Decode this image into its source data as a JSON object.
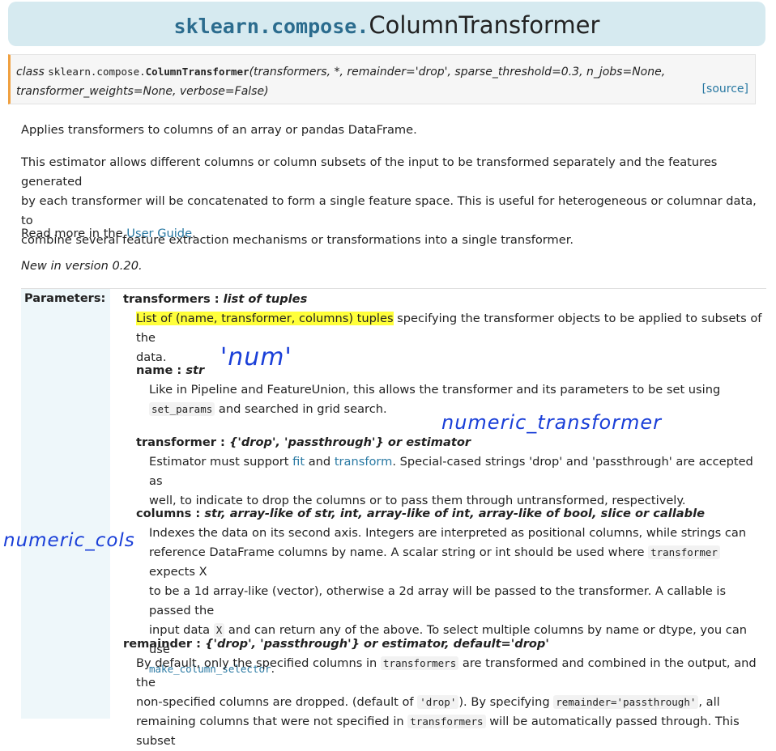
{
  "header": {
    "module": "sklearn.compose.",
    "name": "ColumnTransformer"
  },
  "signature": {
    "keyword": "class",
    "prefix": "sklearn.compose.",
    "cls": "ColumnTransformer",
    "args_line1": "(transformers, *, remainder='drop', sparse_threshold=0.3, n_jobs=None,",
    "args_line2": "transformer_weights=None, verbose=False)",
    "source": "[source]"
  },
  "intro": {
    "p1": "Applies transformers to columns of an array or pandas DataFrame.",
    "p2_l1": "This estimator allows different columns or column subsets of the input to be transformed separately and the features generated",
    "p2_l2": "by each transformer will be concatenated to form a single feature space. This is useful for heterogeneous or columnar data, to",
    "p2_l3": "combine several feature extraction mechanisms or transformations into a single transformer.",
    "p3_pre": "Read more in the ",
    "p3_link": "User Guide",
    "p3_post": ".",
    "p4": "New in version 0.20."
  },
  "params": {
    "label": "Parameters:",
    "transformers": {
      "name": "transformers : ",
      "type": "list of tuples",
      "hl": "List of (name, transformer, columns) tuples",
      "l1_rest": " specifying the transformer objects to be applied to subsets of the",
      "l2": "data."
    },
    "name": {
      "name": "name : ",
      "type": "str",
      "l1": "Like in Pipeline and FeatureUnion, this allows the transformer and its parameters to be set using",
      "code": "set_params",
      "l2_rest": " and searched in grid search."
    },
    "transformer": {
      "name": "transformer : ",
      "type": "{'drop', 'passthrough'} or estimator",
      "l1_pre": "Estimator must support ",
      "fit": "fit",
      "and": " and ",
      "transform": "transform",
      "l1_post": ". Special-cased strings 'drop' and 'passthrough' are accepted as",
      "l2": "well, to indicate to drop the columns or to pass them through untransformed, respectively."
    },
    "columns": {
      "name": "columns : ",
      "type": "str, array-like of str, int, array-like of int, array-like of bool, slice or callable",
      "l1": "Indexes the data on its second axis. Integers are interpreted as positional columns, while strings can",
      "l2_pre": "reference DataFrame columns by name. A scalar string or int should be used where ",
      "l2_code": "transformer",
      "l2_post": " expects X",
      "l3": "to be a 1d array-like (vector), otherwise a 2d array will be passed to the transformer. A callable is passed the",
      "l4_pre": "input data ",
      "l4_code": "X",
      "l4_post": " and can return any of the above. To select multiple columns by name or dtype, you can use",
      "l5_code": "make_column_selector",
      "l5_post": "."
    },
    "remainder": {
      "name": "remainder : ",
      "type": "{'drop', 'passthrough'} or estimator, default='drop'",
      "l1_pre": "By default, only the specified columns in ",
      "l1_code": "transformers",
      "l1_post": " are transformed and combined in the output, and the",
      "l2_pre": "non-specified columns are dropped. (default of ",
      "l2_code": "'drop'",
      "l2_mid": "). By specifying ",
      "l2_code2": "remainder='passthrough'",
      "l2_post": ", all",
      "l3_pre": "remaining columns that were not specified in ",
      "l3_code": "transformers",
      "l3_post": " will be automatically passed through. This subset"
    }
  },
  "annotations": {
    "num": "'num'",
    "numeric_transformer": "numeric_transformer",
    "numeric_cols": "numeric_cols"
  }
}
